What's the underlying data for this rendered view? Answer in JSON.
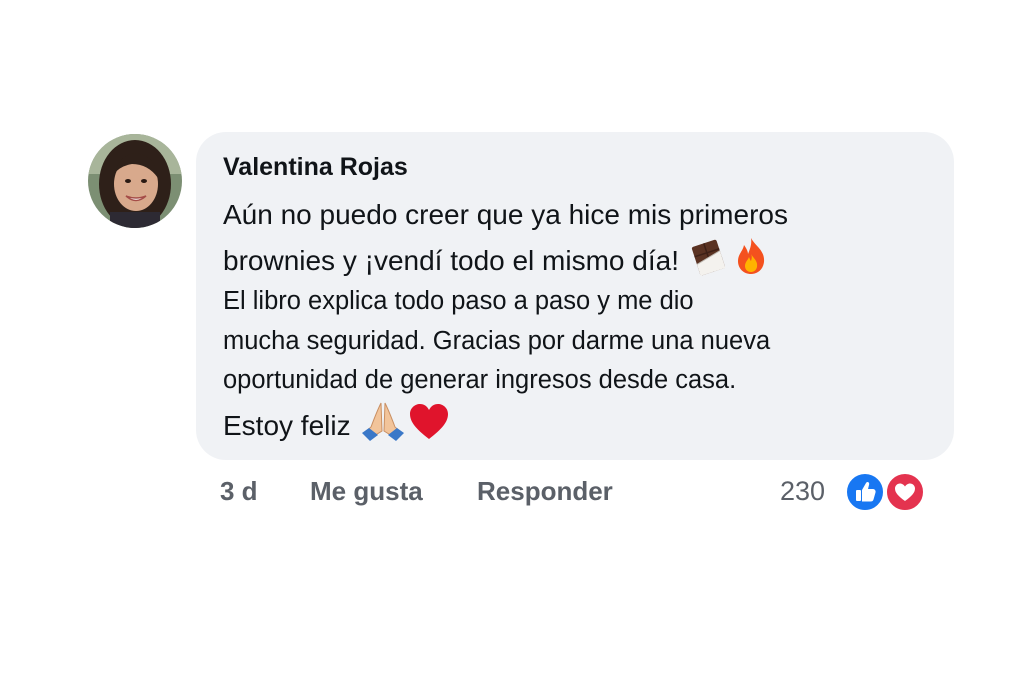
{
  "comment": {
    "author": "Valentina Rojas",
    "lines": {
      "line1": "Aún no puedo creer que ya hice mis primeros",
      "line2": "brownies y ¡vendí todo el mismo día!",
      "line3": "El libro explica todo paso a paso y me dio",
      "line4": "mucha seguridad. Gracias por darme una nueva",
      "line5": "oportunidad de generar ingresos desde casa.",
      "line6": "Estoy feliz"
    },
    "emojis": [
      "chocolate-bar-icon",
      "fire-icon",
      "praying-hands-icon",
      "red-heart-icon"
    ]
  },
  "actions": {
    "time": "3 d",
    "like_label": "Me gusta",
    "reply_label": "Responder"
  },
  "reactions": {
    "count": "230",
    "types": [
      "like-icon",
      "love-icon"
    ]
  },
  "colors": {
    "bubble": "#f0f2f5",
    "text": "#101418",
    "secondary_text": "#5b6068",
    "like_blue": "#1877f2",
    "love_red": "#e4334f"
  }
}
